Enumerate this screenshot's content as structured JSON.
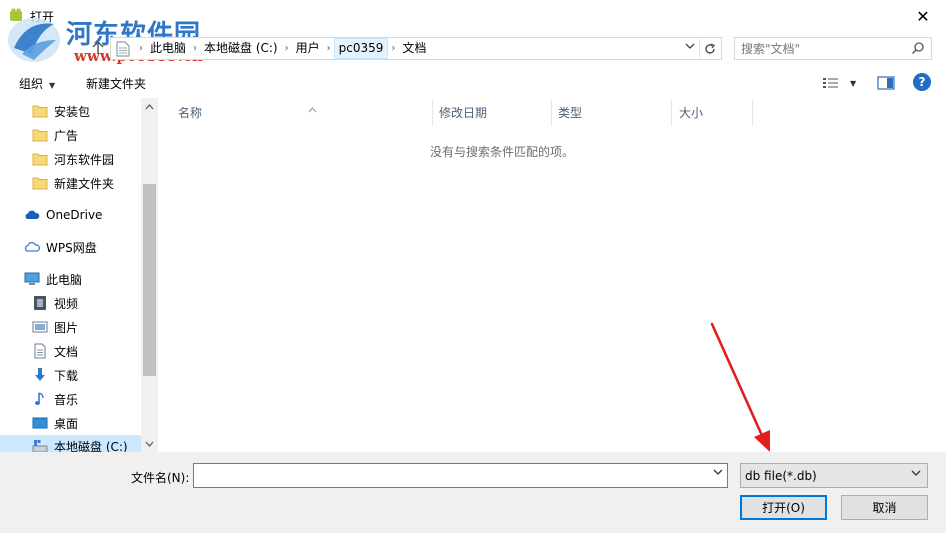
{
  "window": {
    "title": "打开",
    "close_glyph": "✕"
  },
  "watermark": {
    "brand": "河东软件园",
    "url": "www.pc0359.cn"
  },
  "address": {
    "crumbs": [
      "此电脑",
      "本地磁盘 (C:)",
      "用户",
      "pc0359",
      "文档"
    ],
    "separator": "›"
  },
  "search": {
    "placeholder": "搜索\"文档\""
  },
  "toolbar": {
    "organize_label": "组织",
    "new_folder_label": "新建文件夹"
  },
  "nav_pane": {
    "items": [
      {
        "label": "安装包",
        "icon": "folder-icon"
      },
      {
        "label": "广告",
        "icon": "folder-icon"
      },
      {
        "label": "河东软件园",
        "icon": "folder-icon"
      },
      {
        "label": "新建文件夹",
        "icon": "folder-icon"
      },
      {
        "label": "OneDrive",
        "icon": "cloud-icon"
      },
      {
        "label": "WPS网盘",
        "icon": "cloud-outline-icon"
      },
      {
        "label": "此电脑",
        "icon": "computer-icon"
      },
      {
        "label": "视频",
        "icon": "video-icon"
      },
      {
        "label": "图片",
        "icon": "picture-icon"
      },
      {
        "label": "文档",
        "icon": "document-icon"
      },
      {
        "label": "下载",
        "icon": "download-icon"
      },
      {
        "label": "音乐",
        "icon": "music-icon"
      },
      {
        "label": "桌面",
        "icon": "desktop-icon"
      },
      {
        "label": "本地磁盘 (C:)",
        "icon": "drive-icon"
      }
    ]
  },
  "file_list": {
    "columns": [
      "名称",
      "修改日期",
      "类型",
      "大小"
    ],
    "empty_message": "没有与搜索条件匹配的项。"
  },
  "bottom": {
    "filename_label": "文件名(N):",
    "filename_value": "",
    "file_type_value": "db file(*.db)",
    "open_label": "打开(O)",
    "cancel_label": "取消"
  },
  "colors": {
    "accent": "#0078d7",
    "selection": "#cce8ff",
    "annotation_arrow": "#e02020"
  }
}
